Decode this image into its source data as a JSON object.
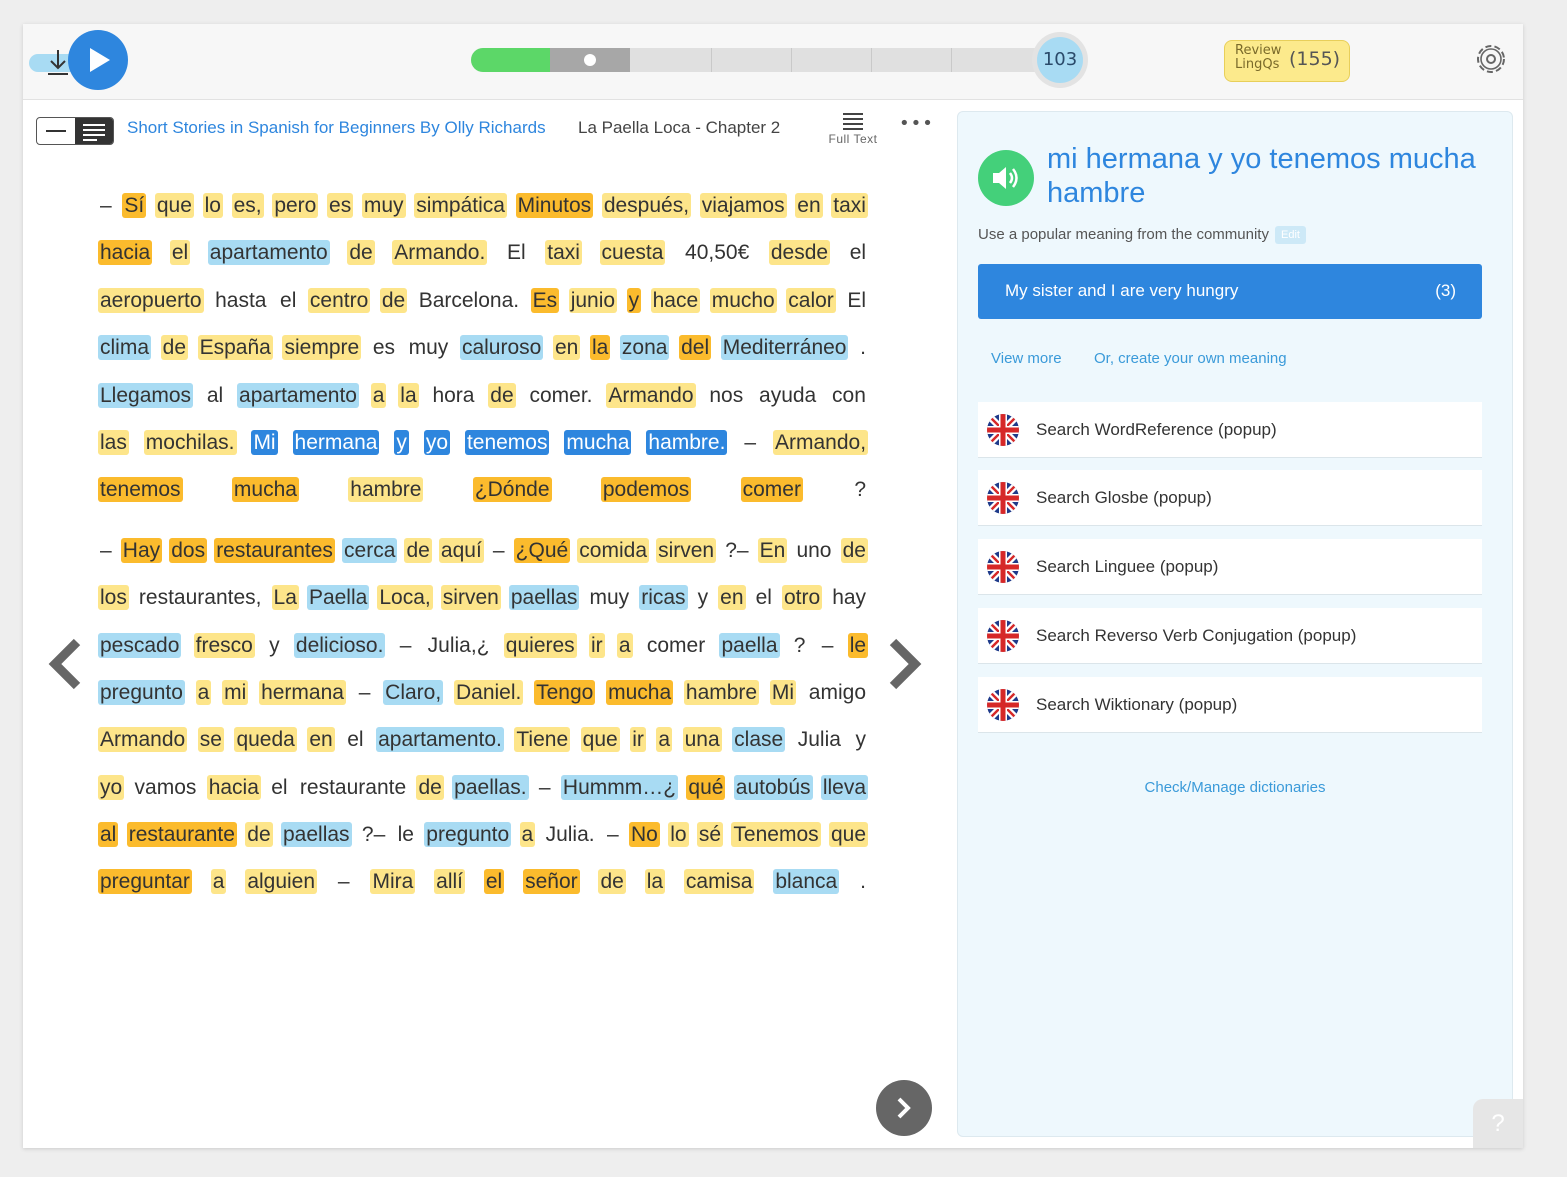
{
  "topbar": {
    "page_number": "103",
    "review_label": "Review LingQs",
    "review_count": "(155)",
    "progress_fraction": 0.27
  },
  "reader": {
    "book_title": "Short Stories in Spanish for Beginners By Olly Richards",
    "chapter_title": "La Paella Loca - Chapter 2",
    "fulltext_label": "Full Text",
    "more_label": "•••"
  },
  "paragraphs": [
    [
      [
        [
          "–",
          "p"
        ],
        [
          "Sí",
          "o"
        ],
        [
          "que",
          "y"
        ],
        [
          "lo",
          "y"
        ],
        [
          "es,",
          "y"
        ],
        [
          "pero",
          "y"
        ],
        [
          "es",
          "y"
        ],
        [
          "muy",
          "y"
        ],
        [
          "simpática",
          "y"
        ],
        [
          "Minutos",
          "o"
        ],
        [
          "después,",
          "y"
        ],
        [
          "viajamos",
          "y"
        ],
        [
          "en",
          "y"
        ],
        [
          "taxi",
          "y"
        ]
      ],
      [
        [
          "hacia",
          "o"
        ],
        [
          "el",
          "y"
        ],
        [
          "apartamento",
          "b"
        ],
        [
          "de",
          "y"
        ],
        [
          "Armando.",
          "y"
        ],
        [
          "El",
          "p"
        ],
        [
          "taxi",
          "y"
        ],
        [
          "cuesta",
          "y"
        ],
        [
          "40,50€",
          "p"
        ],
        [
          "desde",
          "y"
        ],
        [
          "el",
          "p"
        ]
      ],
      [
        [
          "aeropuerto",
          "y"
        ],
        [
          "hasta",
          "p"
        ],
        [
          "el",
          "p"
        ],
        [
          "centro",
          "y"
        ],
        [
          "de",
          "y"
        ],
        [
          "Barcelona.",
          "p"
        ],
        [
          "Es",
          "o"
        ],
        [
          "junio",
          "y"
        ],
        [
          "y",
          "o"
        ],
        [
          "hace",
          "y"
        ],
        [
          "mucho",
          "y"
        ],
        [
          "calor",
          "y"
        ],
        [
          "El",
          "p"
        ]
      ],
      [
        [
          "clima",
          "b"
        ],
        [
          "de",
          "y"
        ],
        [
          "España",
          "y"
        ],
        [
          "siempre",
          "y"
        ],
        [
          "es",
          "p"
        ],
        [
          "muy",
          "p"
        ],
        [
          "caluroso",
          "b"
        ],
        [
          "en",
          "y"
        ],
        [
          "la",
          "o"
        ],
        [
          "zona",
          "b"
        ],
        [
          "del",
          "o"
        ],
        [
          "Mediterráneo",
          "b"
        ],
        [
          ".",
          "p"
        ]
      ],
      [
        [
          "Llegamos",
          "b"
        ],
        [
          "al",
          "p"
        ],
        [
          "apartamento",
          "b"
        ],
        [
          "a",
          "y"
        ],
        [
          "la",
          "y"
        ],
        [
          "hora",
          "p"
        ],
        [
          "de",
          "y"
        ],
        [
          "comer.",
          "p"
        ],
        [
          "Armando",
          "y"
        ],
        [
          "nos",
          "p"
        ],
        [
          "ayuda",
          "p"
        ],
        [
          "con",
          "p"
        ]
      ],
      [
        [
          "las",
          "y"
        ],
        [
          "mochilas.",
          "y"
        ],
        [
          "Mi",
          "s"
        ],
        [
          "hermana",
          "s"
        ],
        [
          "y",
          "s"
        ],
        [
          "yo",
          "s"
        ],
        [
          "tenemos",
          "s"
        ],
        [
          "mucha",
          "s"
        ],
        [
          "hambre.",
          "s"
        ],
        [
          "–",
          "p"
        ],
        [
          "Armando,",
          "y"
        ]
      ],
      [
        [
          "tenemos",
          "o"
        ],
        [
          "mucha",
          "o"
        ],
        [
          "hambre",
          "y"
        ],
        [
          "¿Dónde",
          "o"
        ],
        [
          "podemos",
          "o"
        ],
        [
          "comer",
          "o"
        ],
        [
          "?",
          "p"
        ]
      ]
    ],
    [
      [
        [
          "–",
          "p"
        ],
        [
          "Hay",
          "o"
        ],
        [
          "dos",
          "o"
        ],
        [
          "restaurantes",
          "o"
        ],
        [
          "cerca",
          "b"
        ],
        [
          "de",
          "y"
        ],
        [
          "aquí",
          "y"
        ],
        [
          "–",
          "p"
        ],
        [
          "¿Qué",
          "o"
        ],
        [
          "comida",
          "y"
        ],
        [
          "sirven",
          "y"
        ],
        [
          "?–",
          "p"
        ],
        [
          "En",
          "y"
        ],
        [
          "uno",
          "p"
        ],
        [
          "de",
          "y"
        ]
      ],
      [
        [
          "los",
          "y"
        ],
        [
          "restaurantes,",
          "p"
        ],
        [
          "La",
          "y"
        ],
        [
          "Paella",
          "b"
        ],
        [
          "Loca,",
          "y"
        ],
        [
          "sirven",
          "y"
        ],
        [
          "paellas",
          "b"
        ],
        [
          "muy",
          "p"
        ],
        [
          "ricas",
          "b"
        ],
        [
          "y",
          "p"
        ],
        [
          "en",
          "y"
        ],
        [
          "el",
          "p"
        ],
        [
          "otro",
          "y"
        ],
        [
          "hay",
          "p"
        ]
      ],
      [
        [
          "pescado",
          "b"
        ],
        [
          "fresco",
          "y"
        ],
        [
          "y",
          "p"
        ],
        [
          "delicioso.",
          "b"
        ],
        [
          "–",
          "p"
        ],
        [
          "Julia,¿",
          "p"
        ],
        [
          "quieres",
          "y"
        ],
        [
          "ir",
          "y"
        ],
        [
          "a",
          "y"
        ],
        [
          "comer",
          "p"
        ],
        [
          "paella",
          "b"
        ],
        [
          "?",
          "p"
        ],
        [
          "–",
          "p"
        ],
        [
          "le",
          "o"
        ]
      ],
      [
        [
          "pregunto",
          "b"
        ],
        [
          "a",
          "y"
        ],
        [
          "mi",
          "y"
        ],
        [
          "hermana",
          "y"
        ],
        [
          "–",
          "p"
        ],
        [
          "Claro,",
          "b"
        ],
        [
          "Daniel.",
          "y"
        ],
        [
          "Tengo",
          "o"
        ],
        [
          "mucha",
          "o"
        ],
        [
          "hambre",
          "y"
        ],
        [
          "Mi",
          "y"
        ],
        [
          "amigo",
          "p"
        ]
      ],
      [
        [
          "Armando",
          "y"
        ],
        [
          "se",
          "y"
        ],
        [
          "queda",
          "y"
        ],
        [
          "en",
          "y"
        ],
        [
          "el",
          "p"
        ],
        [
          "apartamento.",
          "b"
        ],
        [
          "Tiene",
          "y"
        ],
        [
          "que",
          "y"
        ],
        [
          "ir",
          "y"
        ],
        [
          "a",
          "y"
        ],
        [
          "una",
          "y"
        ],
        [
          "clase",
          "b"
        ],
        [
          "Julia",
          "p"
        ],
        [
          "y",
          "p"
        ]
      ],
      [
        [
          "yo",
          "y"
        ],
        [
          "vamos",
          "p"
        ],
        [
          "hacia",
          "y"
        ],
        [
          "el",
          "p"
        ],
        [
          "restaurante",
          "p"
        ],
        [
          "de",
          "y"
        ],
        [
          "paellas.",
          "b"
        ],
        [
          "–",
          "p"
        ],
        [
          "Hummm…¿",
          "b"
        ],
        [
          "qué",
          "o"
        ],
        [
          "autobús",
          "b"
        ],
        [
          "lleva",
          "b"
        ]
      ],
      [
        [
          "al",
          "o"
        ],
        [
          "restaurante",
          "o"
        ],
        [
          "de",
          "y"
        ],
        [
          "paellas",
          "b"
        ],
        [
          "?–",
          "p"
        ],
        [
          "le",
          "p"
        ],
        [
          "pregunto",
          "b"
        ],
        [
          "a",
          "y"
        ],
        [
          "Julia.",
          "p"
        ],
        [
          "–",
          "p"
        ],
        [
          "No",
          "o"
        ],
        [
          "lo",
          "y"
        ],
        [
          "sé",
          "y"
        ],
        [
          "Tenemos",
          "y"
        ],
        [
          "que",
          "y"
        ]
      ],
      [
        [
          "preguntar",
          "o"
        ],
        [
          "a",
          "y"
        ],
        [
          "alguien",
          "y"
        ],
        [
          "–",
          "p"
        ],
        [
          "Mira",
          "y"
        ],
        [
          "allí",
          "y"
        ],
        [
          "el",
          "o"
        ],
        [
          "señor",
          "o"
        ],
        [
          "de",
          "y"
        ],
        [
          "la",
          "y"
        ],
        [
          "camisa",
          "y"
        ],
        [
          "blanca",
          "b"
        ],
        [
          ".",
          "p"
        ]
      ]
    ]
  ],
  "sidebar": {
    "phrase": "mi hermana y yo tenemos mucha hambre",
    "community_text": "Use a popular meaning from the community",
    "edit_label": "Edit",
    "meaning_text": "My sister and I are very hungry",
    "meaning_count": "(3)",
    "view_more": "View more",
    "create_meaning": "Or, create your own meaning",
    "dictionaries": [
      "Search WordReference (popup)",
      "Search Glosbe (popup)",
      "Search Linguee (popup)",
      "Search Reverso Verb Conjugation (popup)",
      "Search Wiktionary (popup)"
    ],
    "manage_label": "Check/Manage dictionaries"
  },
  "help_label": "?",
  "colors": {
    "accent_blue": "#2e86de",
    "known_yellow": "#fde58a",
    "lingq_orange": "#fbbb2d",
    "new_blue": "#a8dbf3",
    "play_green": "#44d07a"
  }
}
